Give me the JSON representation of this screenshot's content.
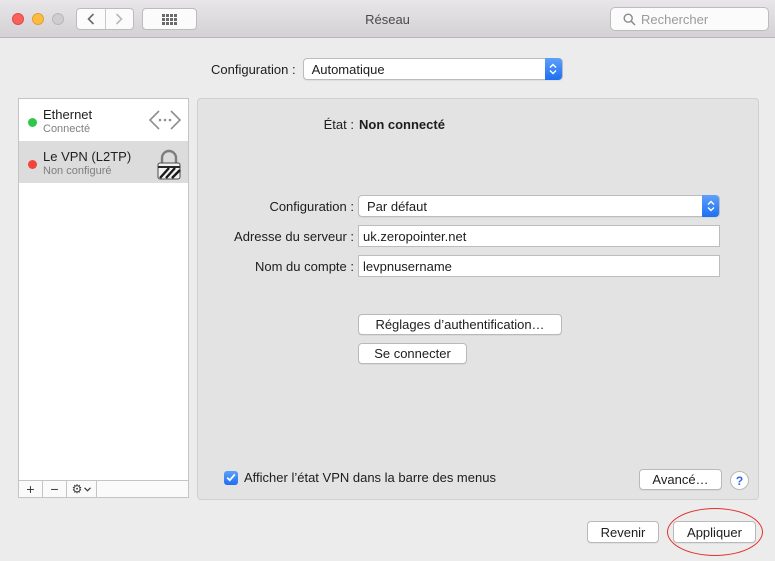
{
  "window": {
    "title": "Réseau",
    "search_placeholder": "Rechercher"
  },
  "top": {
    "config_label": "Configuration :",
    "config_value": "Automatique"
  },
  "services": [
    {
      "name": "Ethernet",
      "status": "Connecté",
      "dot_color": "#2fc74a",
      "icon": "ethernet-arrows-icon"
    },
    {
      "name": "Le VPN (L2TP)",
      "status": "Non configuré",
      "dot_color": "#f0443d",
      "icon": "vpn-lock-icon"
    }
  ],
  "sidebar_toolbar": {
    "add": "+",
    "remove": "−",
    "action": "⚙"
  },
  "detail": {
    "state_label": "État :",
    "state_value": "Non connecté",
    "config_label": "Configuration :",
    "config_value": "Par défaut",
    "server_label": "Adresse du serveur :",
    "server_value": "uk.zeropointer.net",
    "account_label": "Nom du compte :",
    "account_value": "levpnusername",
    "auth_button": "Réglages d’authentification…",
    "connect_button": "Se connecter",
    "show_vpn_label": "Afficher l’état VPN dans la barre des menus",
    "show_vpn_checked": true,
    "advanced_button": "Avancé…",
    "help": "?"
  },
  "footer": {
    "revert_button": "Revenir",
    "apply_button": "Appliquer"
  },
  "colors": {
    "accent": "#1f6ef2",
    "highlight_ring": "#e2312b"
  }
}
